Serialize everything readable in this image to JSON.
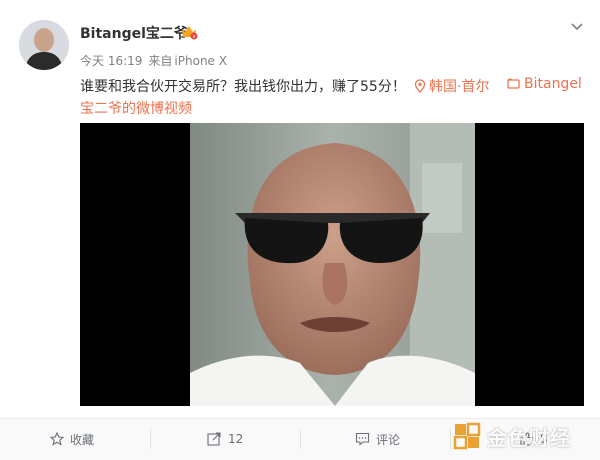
{
  "user": {
    "name": "Bitangel宝二爷",
    "timestamp": "今天 16:19",
    "source_prefix": "来自",
    "device": "iPhone X"
  },
  "post": {
    "text": "谁要和我合伙开交易所？我出钱你出力，赚了55分！",
    "location": "韩国·首尔",
    "source_tag": "Bitangel",
    "video_link": "宝二爷的微博视频"
  },
  "actions": {
    "favorite": "收藏",
    "share_count": "12",
    "comment": "评论",
    "like_count": "8"
  },
  "watermark": {
    "text": "金色财经"
  },
  "colors": {
    "link": "#eb7350",
    "text": "#333333",
    "meta": "#808080",
    "badge": "#f5a623"
  }
}
